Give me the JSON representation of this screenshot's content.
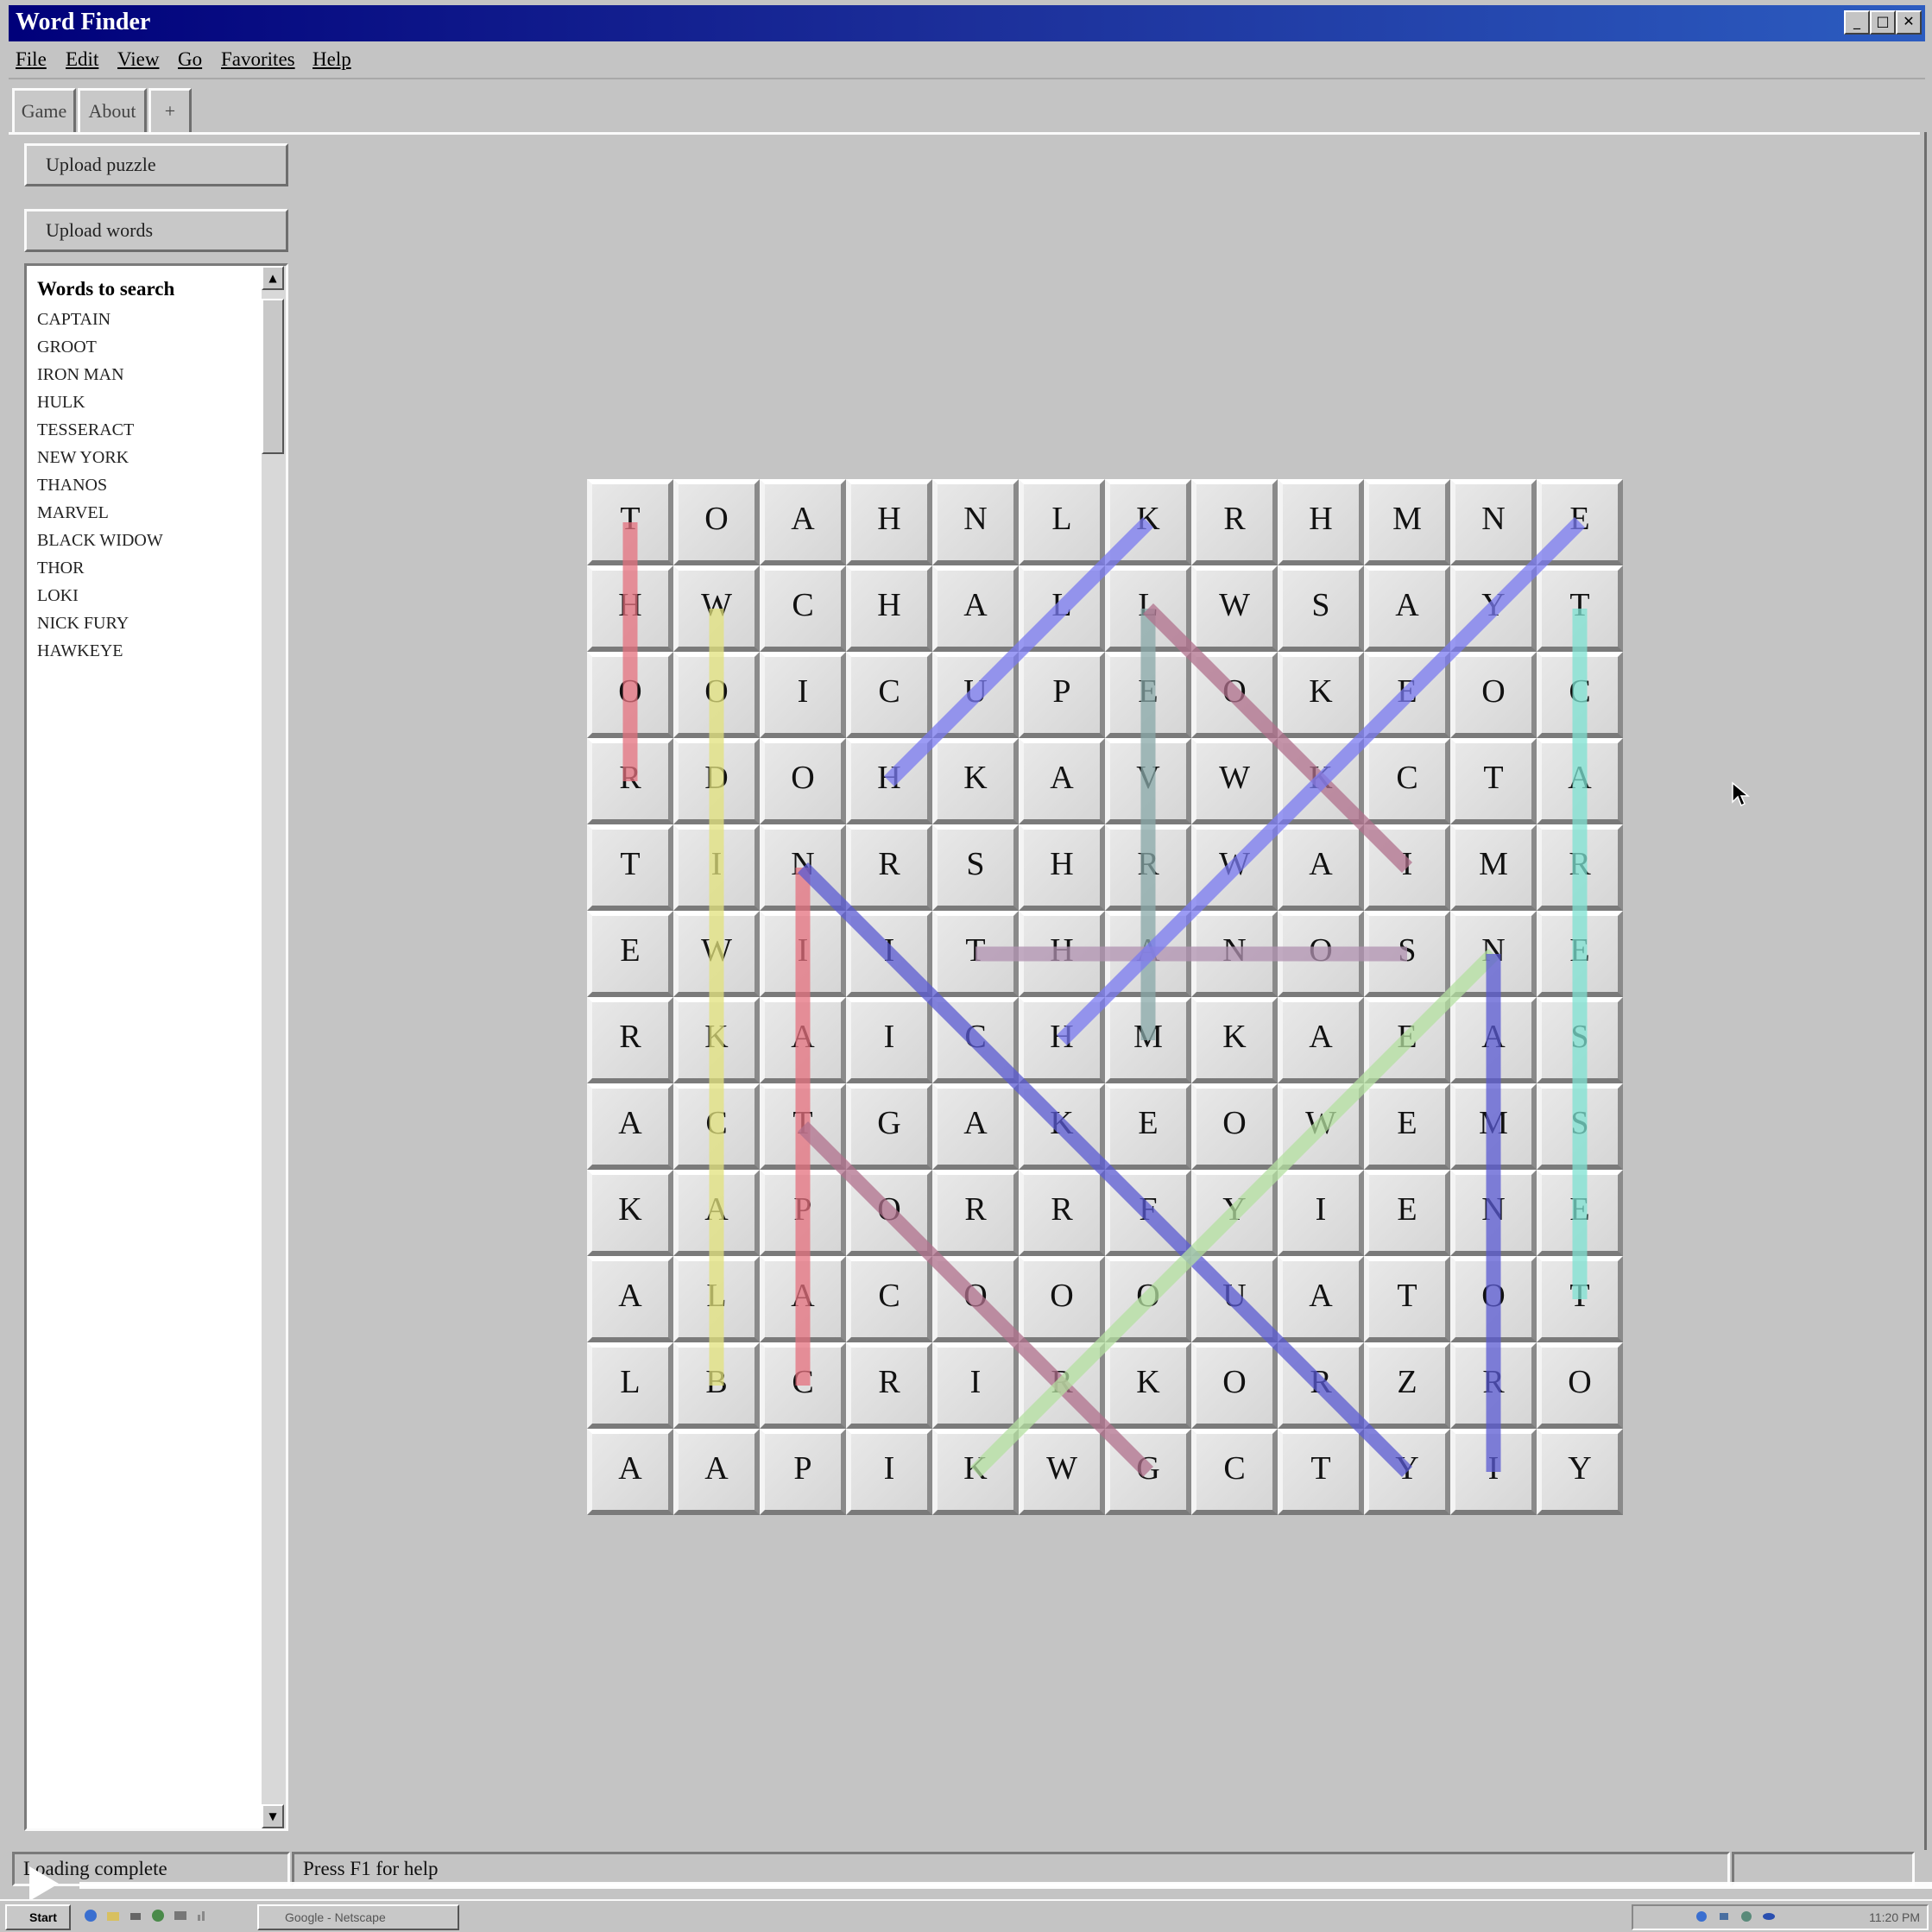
{
  "window": {
    "title": "Word Finder"
  },
  "menu": [
    "File",
    "Edit",
    "View",
    "Go",
    "Favorites",
    "Help"
  ],
  "tabs": [
    "Game",
    "About",
    "+"
  ],
  "sidebar": {
    "upload_puzzle": "Upload puzzle",
    "upload_words": "Upload words",
    "words_heading": "Words to search",
    "words": [
      "CAPTAIN",
      "GROOT",
      "IRON MAN",
      "HULK",
      "TESSERACT",
      "NEW YORK",
      "THANOS",
      "MARVEL",
      "BLACK WIDOW",
      "THOR",
      "LOKI",
      "NICK FURY",
      "HAWKEYE"
    ]
  },
  "grid": [
    [
      "T",
      "O",
      "A",
      "H",
      "N",
      "L",
      "K",
      "R",
      "H",
      "M",
      "N",
      "E"
    ],
    [
      "H",
      "W",
      "C",
      "H",
      "A",
      "L",
      "L",
      "W",
      "S",
      "A",
      "Y",
      "T"
    ],
    [
      "O",
      "O",
      "I",
      "C",
      "U",
      "P",
      "E",
      "O",
      "K",
      "E",
      "O",
      "C"
    ],
    [
      "R",
      "D",
      "O",
      "H",
      "K",
      "A",
      "V",
      "W",
      "K",
      "C",
      "T",
      "A"
    ],
    [
      "T",
      "I",
      "N",
      "R",
      "S",
      "H",
      "R",
      "W",
      "A",
      "I",
      "M",
      "R"
    ],
    [
      "E",
      "W",
      "I",
      "I",
      "T",
      "H",
      "A",
      "N",
      "O",
      "S",
      "N",
      "E"
    ],
    [
      "R",
      "K",
      "A",
      "I",
      "C",
      "H",
      "M",
      "K",
      "A",
      "E",
      "A",
      "S"
    ],
    [
      "A",
      "C",
      "T",
      "G",
      "A",
      "K",
      "E",
      "O",
      "W",
      "E",
      "M",
      "S"
    ],
    [
      "K",
      "A",
      "P",
      "O",
      "R",
      "R",
      "F",
      "Y",
      "I",
      "E",
      "N",
      "E"
    ],
    [
      "A",
      "L",
      "A",
      "C",
      "O",
      "O",
      "O",
      "U",
      "A",
      "T",
      "O",
      "T"
    ],
    [
      "L",
      "B",
      "C",
      "R",
      "I",
      "R",
      "K",
      "O",
      "R",
      "Z",
      "R",
      "O"
    ],
    [
      "A",
      "A",
      "P",
      "I",
      "K",
      "W",
      "G",
      "C",
      "T",
      "Y",
      "I",
      "Y"
    ]
  ],
  "found_lines": [
    {
      "word": "THOR",
      "from": [
        0,
        0
      ],
      "to": [
        3,
        0
      ],
      "color": "#e4707e"
    },
    {
      "word": "BLACK WIDOW",
      "from": [
        10,
        1
      ],
      "to": [
        1,
        1
      ],
      "color": "#e2e27c"
    },
    {
      "word": "CAPTAIN",
      "from": [
        10,
        2
      ],
      "to": [
        4,
        2
      ],
      "color": "#e4707e"
    },
    {
      "word": "HULK",
      "from": [
        3,
        3
      ],
      "to": [
        0,
        6
      ],
      "color": "#7a7af0"
    },
    {
      "word": "MARVEL",
      "from": [
        6,
        6
      ],
      "to": [
        1,
        6
      ],
      "color": "#88a8a8"
    },
    {
      "word": "LOKI",
      "from": [
        1,
        6
      ],
      "to": [
        4,
        9
      ],
      "color": "#b0708c"
    },
    {
      "word": "THANOS",
      "from": [
        5,
        4
      ],
      "to": [
        5,
        9
      ],
      "color": "#b092b0"
    },
    {
      "word": "HAWKEYE",
      "from": [
        6,
        5
      ],
      "to": [
        0,
        11
      ],
      "color": "#7a7af0"
    },
    {
      "word": "NICK FURY",
      "from": [
        4,
        2
      ],
      "to": [
        11,
        9
      ],
      "color": "#5a5ad2"
    },
    {
      "word": "GROOT",
      "from": [
        11,
        6
      ],
      "to": [
        7,
        2
      ],
      "color": "#b0708c"
    },
    {
      "word": "NEW YORK",
      "from": [
        5,
        10
      ],
      "to": [
        11,
        4
      ],
      "color": "#b4e0a0"
    },
    {
      "word": "IRON MAN",
      "from": [
        11,
        10
      ],
      "to": [
        5,
        10
      ],
      "color": "#5a5ad2"
    },
    {
      "word": "TESSERACT",
      "from": [
        9,
        11
      ],
      "to": [
        1,
        11
      ],
      "color": "#7ee2d2"
    }
  ],
  "status": {
    "left": "Loading complete",
    "right": "Press F1 for help"
  },
  "taskbar": {
    "start": "Start",
    "task": "Google - Netscape",
    "clock": "11:20 PM"
  }
}
